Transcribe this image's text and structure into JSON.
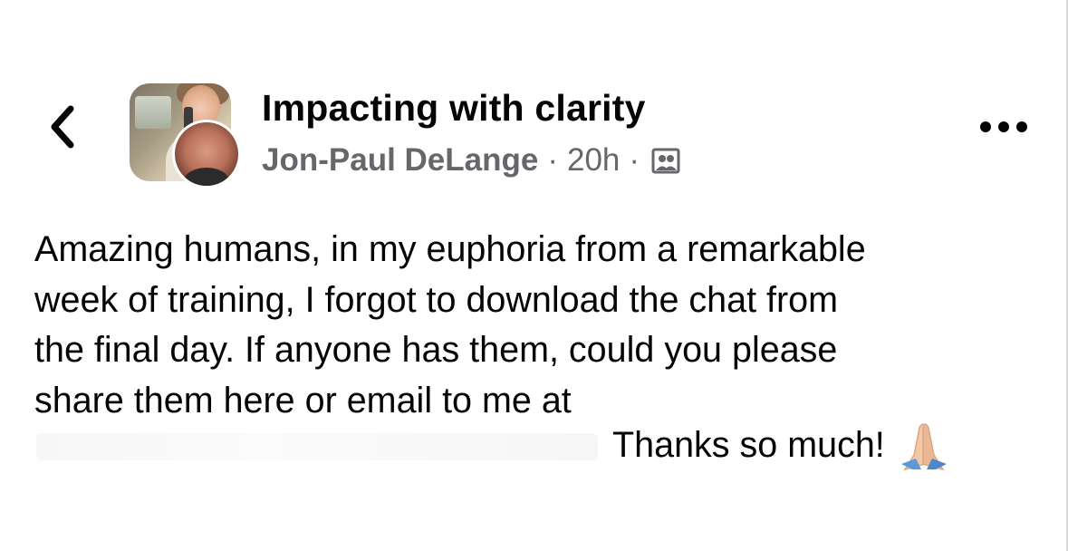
{
  "header": {
    "back_icon": "chevron-left-icon",
    "group_name": "Impacting with clarity",
    "author": "Jon-Paul DeLange",
    "separator": "·",
    "time": "20h",
    "audience_icon": "group-members-icon",
    "more_icon": "more-horizontal-icon"
  },
  "post": {
    "lines": [
      "Amazing humans, in my euphoria from a remarkable",
      "week of training, I forgot to download the chat from",
      "the final day. If anyone has them, could you please",
      "share them here or email to me at"
    ],
    "closing": "Thanks so much!",
    "emoji": "folded-hands-icon"
  },
  "colors": {
    "text": "#050505",
    "meta": "#65676b",
    "background": "#ffffff"
  }
}
